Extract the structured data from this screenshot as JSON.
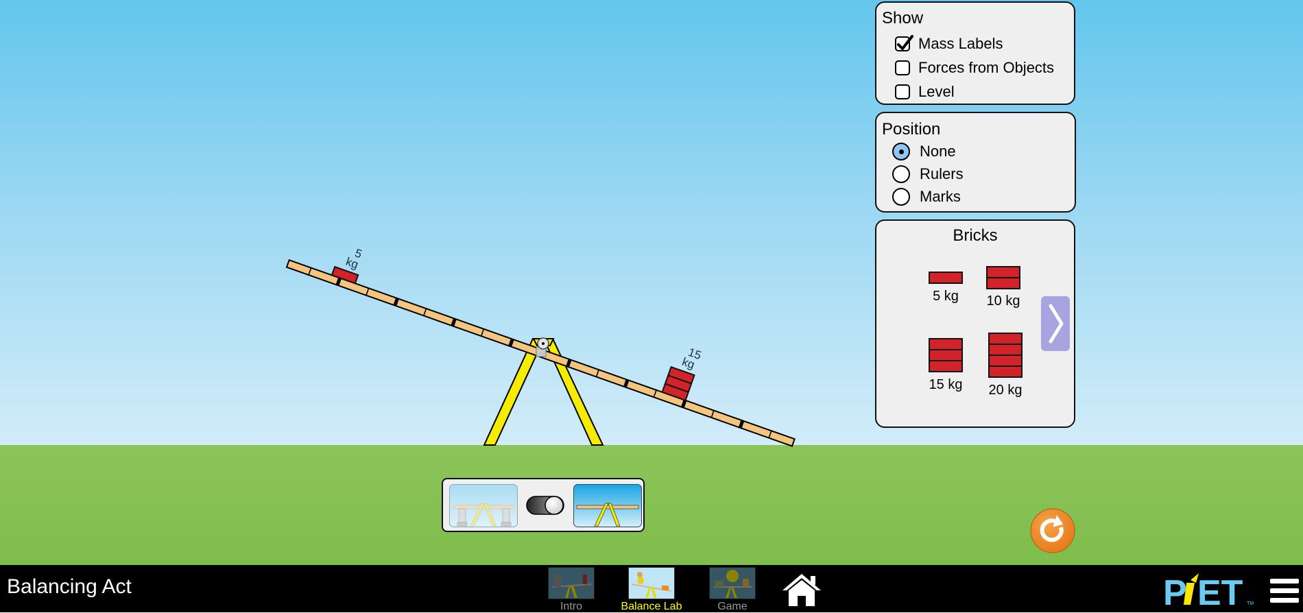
{
  "app": {
    "title": "Balancing Act"
  },
  "show_panel": {
    "title": "Show",
    "options": [
      {
        "label": "Mass Labels",
        "checked": true
      },
      {
        "label": "Forces from Objects",
        "checked": false
      },
      {
        "label": "Level",
        "checked": false
      }
    ]
  },
  "position_panel": {
    "title": "Position",
    "options": [
      {
        "label": "None",
        "selected": true
      },
      {
        "label": "Rulers",
        "selected": false
      },
      {
        "label": "Marks",
        "selected": false
      }
    ]
  },
  "bricks_panel": {
    "title": "Bricks",
    "items": [
      {
        "label": "5 kg",
        "mass_kg": 5,
        "stack": 1
      },
      {
        "label": "10 kg",
        "mass_kg": 10,
        "stack": 2
      },
      {
        "label": "15 kg",
        "mass_kg": 15,
        "stack": 3
      },
      {
        "label": "20 kg",
        "mass_kg": 20,
        "stack": 4
      }
    ],
    "next_icon": "chevron-right-icon"
  },
  "plank": {
    "tilt": "right side down",
    "bricks_on_plank": [
      {
        "mass_label_value": "5",
        "mass_label_unit": "kg",
        "stack": 1,
        "side": "left"
      },
      {
        "mass_label_value": "15",
        "mass_label_unit": "kg",
        "stack": 3,
        "side": "right"
      }
    ]
  },
  "support_toggle": {
    "state": "supports removed"
  },
  "navbar": {
    "screens": [
      {
        "label": "Intro",
        "selected": false
      },
      {
        "label": "Balance Lab",
        "selected": true
      },
      {
        "label": "Game",
        "selected": false
      }
    ],
    "home_icon": "home-icon",
    "logo": "PhET",
    "menu_icon": "hamburger-menu-icon"
  },
  "colors": {
    "brick_red": "#d2232a",
    "plank_tan": "#f3c57f",
    "fulcrum_yellow": "#f5ec00",
    "selected_screen_yellow": "#ffff00",
    "unselected_screen_gray": "#999999",
    "reset_orange": "#f0892a",
    "next_button_purple": "#a8a4e0",
    "radio_selected_blue": "#92c5f5",
    "phet_blue": "#6acbf2",
    "phet_yellow": "#fde600"
  }
}
